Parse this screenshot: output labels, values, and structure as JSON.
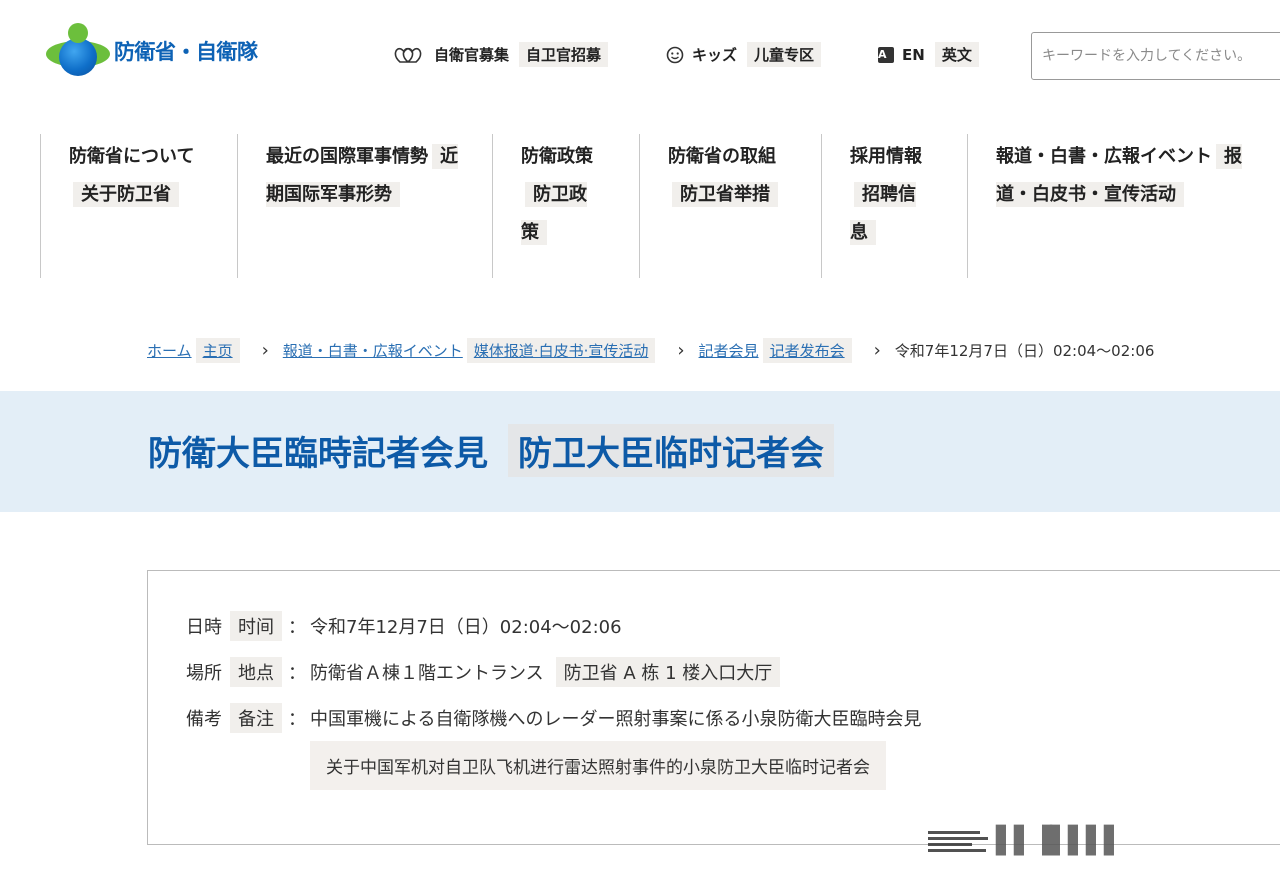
{
  "header": {
    "logo_text": "防衛省・自衛隊",
    "recruit": {
      "label": "自衛官募集",
      "translation": "自卫官招募",
      "icon": "hearts-icon"
    },
    "kids": {
      "label": "キッズ",
      "translation": "儿童专区",
      "icon": "smiley-icon"
    },
    "english": {
      "label": "EN",
      "translation": "英文",
      "icon_letter": "A"
    },
    "search": {
      "placeholder": "キーワードを入力してください。"
    }
  },
  "nav": {
    "items": [
      {
        "label": "防衛省について",
        "translation": "关于防卫省"
      },
      {
        "label": "最近の国際軍事情勢",
        "translation": "近期国际军事形势"
      },
      {
        "label": "防衛政策",
        "translation": "防卫政策"
      },
      {
        "label": "防衛省の取組",
        "translation": "防卫省举措"
      },
      {
        "label": "採用情報",
        "translation": "招聘信息"
      },
      {
        "label": "報道・白書・広報イベント",
        "translation": "报道・白皮书・宣传活动"
      }
    ]
  },
  "breadcrumb": {
    "home": "ホーム",
    "home_tr": "主页",
    "section": "報道・白書・広報イベント",
    "section_tr": "媒体报道·白皮书·宣传活动",
    "sub": "記者会見",
    "sub_tr": "记者发布会",
    "current": "令和7年12月7日（日）02:04～02:06"
  },
  "page": {
    "title": "防衛大臣臨時記者会見",
    "title_tr": "防卫大臣临时记者会"
  },
  "info": {
    "date_label": "日時",
    "date_label_tr": "时间",
    "date_value": "令和7年12月7日（日）02:04～02:06",
    "place_label": "場所",
    "place_label_tr": "地点",
    "place_value": "防衛省Ａ棟１階エントランス",
    "place_value_tr": "防卫省 A 栋 1 楼入口大厅",
    "note_label": "備考",
    "note_label_tr": "备注",
    "note_value": "中国軍機による自衛隊機へのレーダー照射事案に係る小泉防衛大臣臨時会見",
    "note_value_tr": "关于中国军机对自卫队飞机进行雷达照射事件的小泉防卫大臣临时记者会",
    "colon": "："
  },
  "colors": {
    "brand_blue": "#0d62b5",
    "band": "#e3eef7",
    "link": "#2a6fb3",
    "logo_green": "#6cbf3c"
  }
}
